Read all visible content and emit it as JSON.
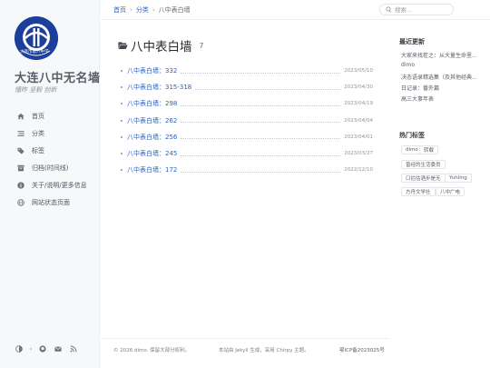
{
  "sidebar": {
    "avatar_text": "大连市第八中学",
    "title": "大连八中无名墙",
    "subtitle": "懂昨 坚毅 创新",
    "nav": [
      {
        "label": "首页",
        "icon": "home-icon"
      },
      {
        "label": "分类",
        "icon": "stream-icon"
      },
      {
        "label": "标签",
        "icon": "tag-icon"
      },
      {
        "label": "归档(时间线)",
        "icon": "archive-icon"
      },
      {
        "label": "关于/说明/更多信息",
        "icon": "info-icon"
      },
      {
        "label": "网站状态页面",
        "icon": "globe-icon"
      }
    ],
    "bottom_icons": [
      "theme-toggle-icon",
      "github-icon",
      "email-icon",
      "rss-icon"
    ]
  },
  "topbar": {
    "breadcrumb": {
      "home": "首页",
      "category": "分类",
      "current": "八中表白墙"
    },
    "search_placeholder": "搜索..."
  },
  "main": {
    "title": "八中表白墙",
    "count": "7",
    "posts": [
      {
        "title": "八中表白墙：332",
        "date": "2023/05/10"
      },
      {
        "title": "八中表白墙：315-318",
        "date": "2023/04/30"
      },
      {
        "title": "八中表白墙：298",
        "date": "2023/04/19"
      },
      {
        "title": "八中表白墙：262",
        "date": "2023/04/04"
      },
      {
        "title": "八中表白墙：256",
        "date": "2023/04/01"
      },
      {
        "title": "八中表白墙：245",
        "date": "2023/03/27"
      },
      {
        "title": "八中表白墙：172",
        "date": "2022/12/10"
      }
    ]
  },
  "right_panel": {
    "recent_heading": "最近更新",
    "recent": [
      "大家来找茬之：从大量生命里...",
      "dimo",
      "决态语录精选集（及其他经典...",
      "日记录：番外篇",
      "高三大事年表"
    ],
    "tags_heading": "热门标签",
    "tags": [
      "dimo",
      "转载",
      "曾经的生活委员",
      "口估估酒步是无",
      "Yuhling",
      "方舟文学社",
      "八中广电"
    ]
  },
  "footer": {
    "copyright_prefix": "© 2026 ",
    "copyright_author": "dimo",
    "copyright_suffix": ". 保留大部分权利。",
    "powered_prefix": "本站由 ",
    "jekyll": "Jekyll",
    "powered_middle": " 生成，采用 ",
    "chirpy": "Chirpy",
    "powered_suffix": " 主题。",
    "icp": "鄂ICP备2023025号"
  },
  "colors": {
    "accent": "#2a62c5",
    "sidebar_bg": "#f6f8fa",
    "avatar_bg": "#1b3f9a"
  }
}
